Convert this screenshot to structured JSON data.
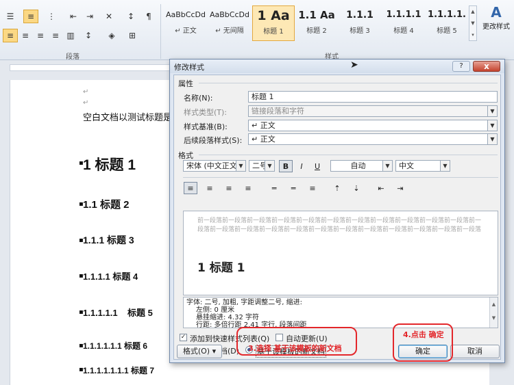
{
  "ribbon": {
    "paragraph_group_label": "段落",
    "styles_group_label": "样式",
    "change_styles_label": "更改样式",
    "styles": [
      {
        "preview": "AaBbCcDd",
        "name": "↵ 正文"
      },
      {
        "preview": "AaBbCcDd",
        "name": "↵ 无间隔"
      },
      {
        "preview": "1  Aa",
        "name": "标题 1"
      },
      {
        "preview": "1.1  Aa",
        "name": "标题 2"
      },
      {
        "preview": "1.1.1",
        "name": "标题 3"
      },
      {
        "preview": "1.1.1.1",
        "name": "标题 4"
      },
      {
        "preview": "1.1.1.1.",
        "name": "标题 5"
      }
    ]
  },
  "document": {
    "body_text": "空白文档以测试标题是否",
    "headings": [
      "1  标题 1",
      "1.1  标题 2",
      "1.1.1 标题 3",
      "1.1.1.1 标题 4",
      "1.1.1.1.1    标题 5",
      "1.1.1.1.1.1 标题 6",
      "1.1.1.1.1.1.1 标题 7"
    ]
  },
  "dialog": {
    "title": "修改样式",
    "close_label": "x",
    "properties_section": "属性",
    "name_label": "名称(N):",
    "name_value": "标题 1",
    "style_type_label": "样式类型(T):",
    "style_type_value": "链接段落和字符",
    "based_on_label": "样式基准(B):",
    "based_on_value": "↵ 正文",
    "following_label": "后续段落样式(S):",
    "following_value": "↵ 正文",
    "format_section": "格式",
    "font_value": "宋体 (中文正文",
    "size_value": "二号",
    "bold_label": "B",
    "italic_label": "I",
    "underline_label": "U",
    "color_value": "自动",
    "language_value": "中文",
    "preview_prev_text": "前一段落前一段落前一段落前一段落前一段落前一段落前一段落前一段落前一段落前一段落前一段落前一段落前一段落前一段落前一段落前一段落前一段落前一段落前一段落前一段落前一段落前一段落前一段落",
    "preview_heading": "1  标题 1",
    "description_line1": "字体: 二号, 加粗, 字距调整二号, 缩进:",
    "description_line2": "左侧:  0 厘米",
    "description_line3": "悬挂缩进: 4.32 字符",
    "description_line4": "行距: 多倍行距 2.41 字行, 段落间距",
    "add_to_quick_label": "添加到快速样式列表(Q)",
    "auto_update_label": "自动更新(U)",
    "only_this_doc_label": "仅限此文档(D)",
    "new_docs_template_label": "基于该模板的新文档",
    "format_button": "格式(O) ▾",
    "ok_button": "确定",
    "cancel_button": "取消"
  },
  "annotations": {
    "step3": "3.选择 基于该模板的新文档",
    "step4": "4.点击 确定",
    "color": "#e3262a"
  }
}
